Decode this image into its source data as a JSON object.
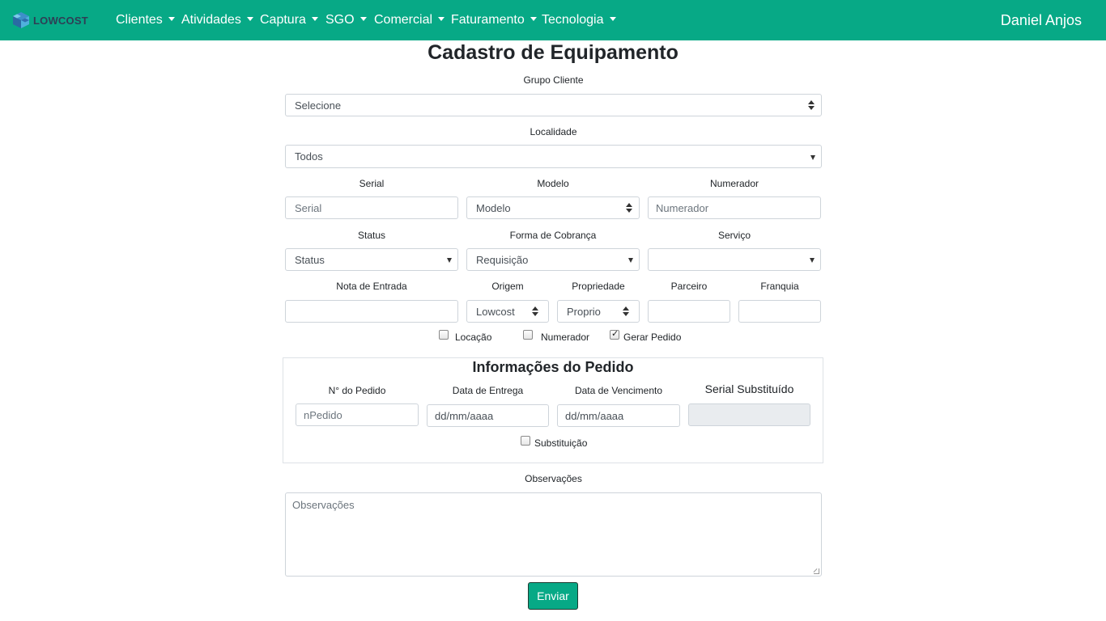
{
  "navbar": {
    "logo_text": "LOWCOST",
    "menu": [
      {
        "label": "Clientes"
      },
      {
        "label": "Atividades"
      },
      {
        "label": "Captura"
      },
      {
        "label": "SGO"
      },
      {
        "label": "Comercial"
      },
      {
        "label": "Faturamento"
      },
      {
        "label": "Tecnologia"
      }
    ],
    "user": "Daniel Anjos"
  },
  "page": {
    "title": "Cadastro de Equipamento"
  },
  "form": {
    "grupo_cliente": {
      "label": "Grupo Cliente",
      "value": "Selecione"
    },
    "localidade": {
      "label": "Localidade",
      "value": "Todos"
    },
    "serial": {
      "label": "Serial",
      "placeholder": "Serial"
    },
    "modelo": {
      "label": "Modelo",
      "value": "Modelo"
    },
    "numerador": {
      "label": "Numerador",
      "placeholder": "Numerador"
    },
    "status": {
      "label": "Status",
      "value": "Status"
    },
    "forma_cobranca": {
      "label": "Forma de Cobrança",
      "value": "Requisição"
    },
    "servico": {
      "label": "Serviço",
      "value": ""
    },
    "nota_entrada": {
      "label": "Nota de Entrada",
      "value": ""
    },
    "origem": {
      "label": "Origem",
      "value": "Lowcost"
    },
    "propriedade": {
      "label": "Propriedade",
      "value": "Proprio"
    },
    "parceiro": {
      "label": "Parceiro",
      "value": ""
    },
    "franquia": {
      "label": "Franquia",
      "value": ""
    },
    "checkboxes": {
      "locacao": {
        "label": "Locação",
        "checked": false
      },
      "numerador": {
        "label": "Numerador",
        "checked": false
      },
      "gerar_pedido": {
        "label": "Gerar Pedido",
        "checked": true
      }
    }
  },
  "pedido": {
    "title": "Informações do Pedido",
    "n_pedido": {
      "label": "N° do Pedido",
      "placeholder": "nPedido"
    },
    "data_entrega": {
      "label": "Data de Entrega",
      "value": "dd/mm/aaaa"
    },
    "data_vencimento": {
      "label": "Data de Vencimento",
      "value": "dd/mm/aaaa"
    },
    "serial_substituido": {
      "label": "Serial Substituído",
      "value": ""
    },
    "substituicao": {
      "label": "Substituição",
      "checked": false
    }
  },
  "observacoes": {
    "label": "Observações",
    "placeholder": "Observações"
  },
  "submit": {
    "label": "Enviar"
  },
  "colors": {
    "brand": "#07a986",
    "logo_text": "#2f3e55"
  }
}
